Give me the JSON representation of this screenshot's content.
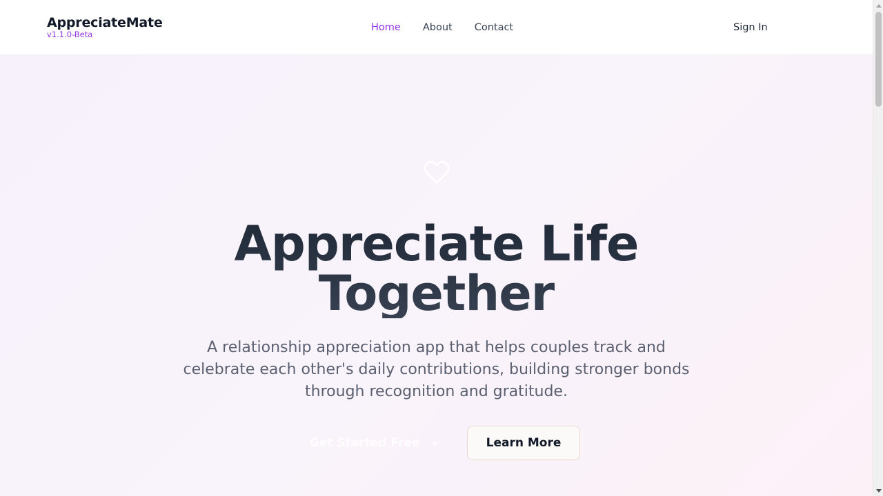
{
  "header": {
    "brand": "AppreciateMate",
    "version": "v1.1.0-Beta",
    "nav": [
      {
        "label": "Home",
        "active": true
      },
      {
        "label": "About",
        "active": false
      },
      {
        "label": "Contact",
        "active": false
      }
    ],
    "sign_in": "Sign In"
  },
  "hero": {
    "icon": "heart-icon",
    "title_line1": "Appreciate Life",
    "title_line2": "Together",
    "subtitle": "A relationship appreciation app that helps couples track and celebrate each other's daily contributions, building stronger bonds through recognition and gratitude.",
    "primary_button": "Get Started Free",
    "primary_button_icon": "arrow-right-icon",
    "secondary_button": "Learn More"
  },
  "colors": {
    "accent": "#9333ea",
    "text_dark": "#1f2937",
    "hero_bg_start": "#f6f1fb",
    "hero_bg_end": "#fcf1f7"
  }
}
